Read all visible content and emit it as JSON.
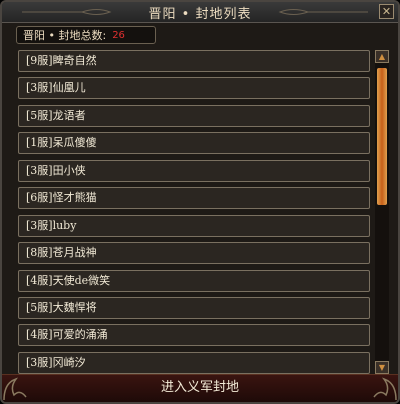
{
  "window": {
    "title": "晋阳 • 封地列表",
    "close_icon": "close-x-icon"
  },
  "summary": {
    "label": "晋阳 • 封地总数:",
    "count": "26"
  },
  "fiefs": [
    {
      "label": "[9服]睥奇自然"
    },
    {
      "label": "[3服]仙凰儿"
    },
    {
      "label": "[5服]龙语者"
    },
    {
      "label": "[1服]呆瓜傻傻"
    },
    {
      "label": "[3服]田小侠"
    },
    {
      "label": "[6服]怪才熊猫"
    },
    {
      "label": "[3服]luby"
    },
    {
      "label": "[8服]苍月战神"
    },
    {
      "label": "[4服]天使de微笑"
    },
    {
      "label": "[5服]大魏悍将"
    },
    {
      "label": "[4服]可爱的涌涌"
    },
    {
      "label": "[3服]冈崎汐"
    }
  ],
  "scroll": {
    "position_fraction": 0.0,
    "visible_fraction": 0.46
  },
  "footer": {
    "enter_label": "进入义军封地"
  },
  "colors": {
    "accent": "#d07020",
    "count": "#e03030",
    "text": "#f2ead6"
  }
}
